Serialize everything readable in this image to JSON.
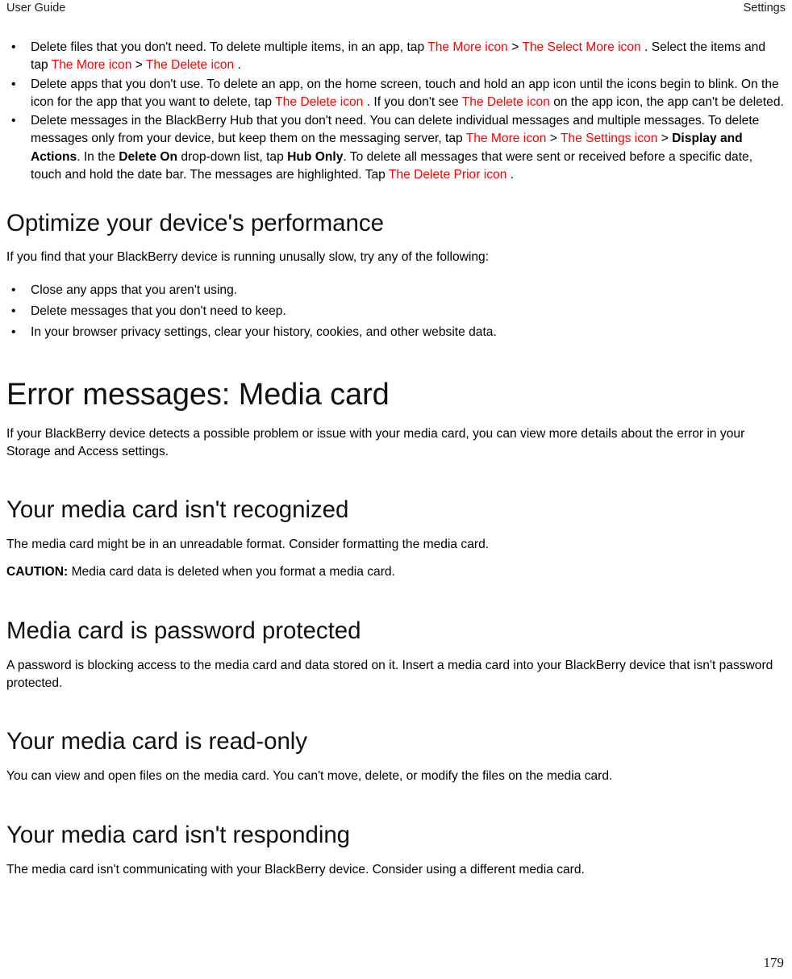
{
  "header": {
    "left": "User Guide",
    "right": "Settings"
  },
  "footer": {
    "page_number": "179"
  },
  "colors": {
    "link_red": "#ff0000",
    "text_black": "#000000",
    "page_background": "#ffffff"
  },
  "top_list": {
    "items": [
      {
        "runs": [
          {
            "type": "text",
            "text": "Delete files that you don't need. To delete multiple items, in an app, tap "
          },
          {
            "type": "link",
            "text": "The More icon"
          },
          {
            "type": "sep",
            "text": " > "
          },
          {
            "type": "link",
            "text": "The Select More icon"
          },
          {
            "type": "text",
            "text": " . Select the items and tap "
          },
          {
            "type": "link",
            "text": "The More icon"
          },
          {
            "type": "sep",
            "text": " > "
          },
          {
            "type": "link",
            "text": "The Delete icon"
          },
          {
            "type": "text",
            "text": " ."
          }
        ]
      },
      {
        "runs": [
          {
            "type": "text",
            "text": "Delete apps that you don't use. To delete an app, on the home screen, touch and hold an app icon until the icons begin to blink. On the icon for the app that you want to delete, tap "
          },
          {
            "type": "link",
            "text": "The Delete icon"
          },
          {
            "type": "text",
            "text": " . If you don't see "
          },
          {
            "type": "link",
            "text": "The Delete icon"
          },
          {
            "type": "text",
            "text": " on the app icon, the app can't be deleted."
          }
        ]
      },
      {
        "runs": [
          {
            "type": "text",
            "text": "Delete messages in the BlackBerry Hub that you don't need. You can delete individual messages and multiple messages. To delete messages only from your device, but keep them on the messaging server, tap "
          },
          {
            "type": "link",
            "text": "The More icon"
          },
          {
            "type": "sep",
            "text": " > "
          },
          {
            "type": "link",
            "text": "The Settings icon"
          },
          {
            "type": "sep",
            "text": " > "
          },
          {
            "type": "bold",
            "text": "Display and Actions"
          },
          {
            "type": "text",
            "text": ". In the "
          },
          {
            "type": "bold",
            "text": "Delete On"
          },
          {
            "type": "text",
            "text": " drop-down list, tap "
          },
          {
            "type": "bold",
            "text": "Hub Only"
          },
          {
            "type": "text",
            "text": ". To delete all messages that were sent or received before a specific date, touch and hold the date bar. The messages are highlighted. Tap "
          },
          {
            "type": "link",
            "text": "The Delete Prior icon"
          },
          {
            "type": "text",
            "text": " ."
          }
        ]
      }
    ]
  },
  "optimize_section": {
    "heading": "Optimize your device's performance",
    "intro": "If you find that your BlackBerry device is running unusally slow, try any of the following:",
    "bullets": [
      "Close any apps that you aren't using.",
      "Delete messages that you don't need to keep.",
      "In your browser privacy settings, clear your history, cookies, and other website data."
    ]
  },
  "error_section": {
    "heading": "Error messages: Media card",
    "intro": "If your BlackBerry device detects a possible problem or issue with your media card, you can view more details about the error in your Storage and Access settings."
  },
  "subsections": [
    {
      "heading": "Your media card isn't recognized",
      "paragraphs": [
        {
          "runs": [
            {
              "type": "text",
              "text": "The media card might be in an unreadable format. Consider formatting the media card."
            }
          ]
        },
        {
          "runs": [
            {
              "type": "bold",
              "text": "CAUTION:"
            },
            {
              "type": "text",
              "text": " Media card data is deleted when you format a media card."
            }
          ]
        }
      ]
    },
    {
      "heading": "Media card is password protected",
      "paragraphs": [
        {
          "runs": [
            {
              "type": "text",
              "text": "A password is blocking access to the media card and data stored on it. Insert a media card into your BlackBerry device that isn't password protected."
            }
          ]
        }
      ]
    },
    {
      "heading": "Your media card is read-only",
      "paragraphs": [
        {
          "runs": [
            {
              "type": "text",
              "text": "You can view and open files on the media card. You can't move, delete, or modify the files on the media card."
            }
          ]
        }
      ]
    },
    {
      "heading": "Your media card isn't responding",
      "paragraphs": [
        {
          "runs": [
            {
              "type": "text",
              "text": "The media card isn't communicating with your BlackBerry device. Consider using a different media card."
            }
          ]
        }
      ]
    }
  ]
}
